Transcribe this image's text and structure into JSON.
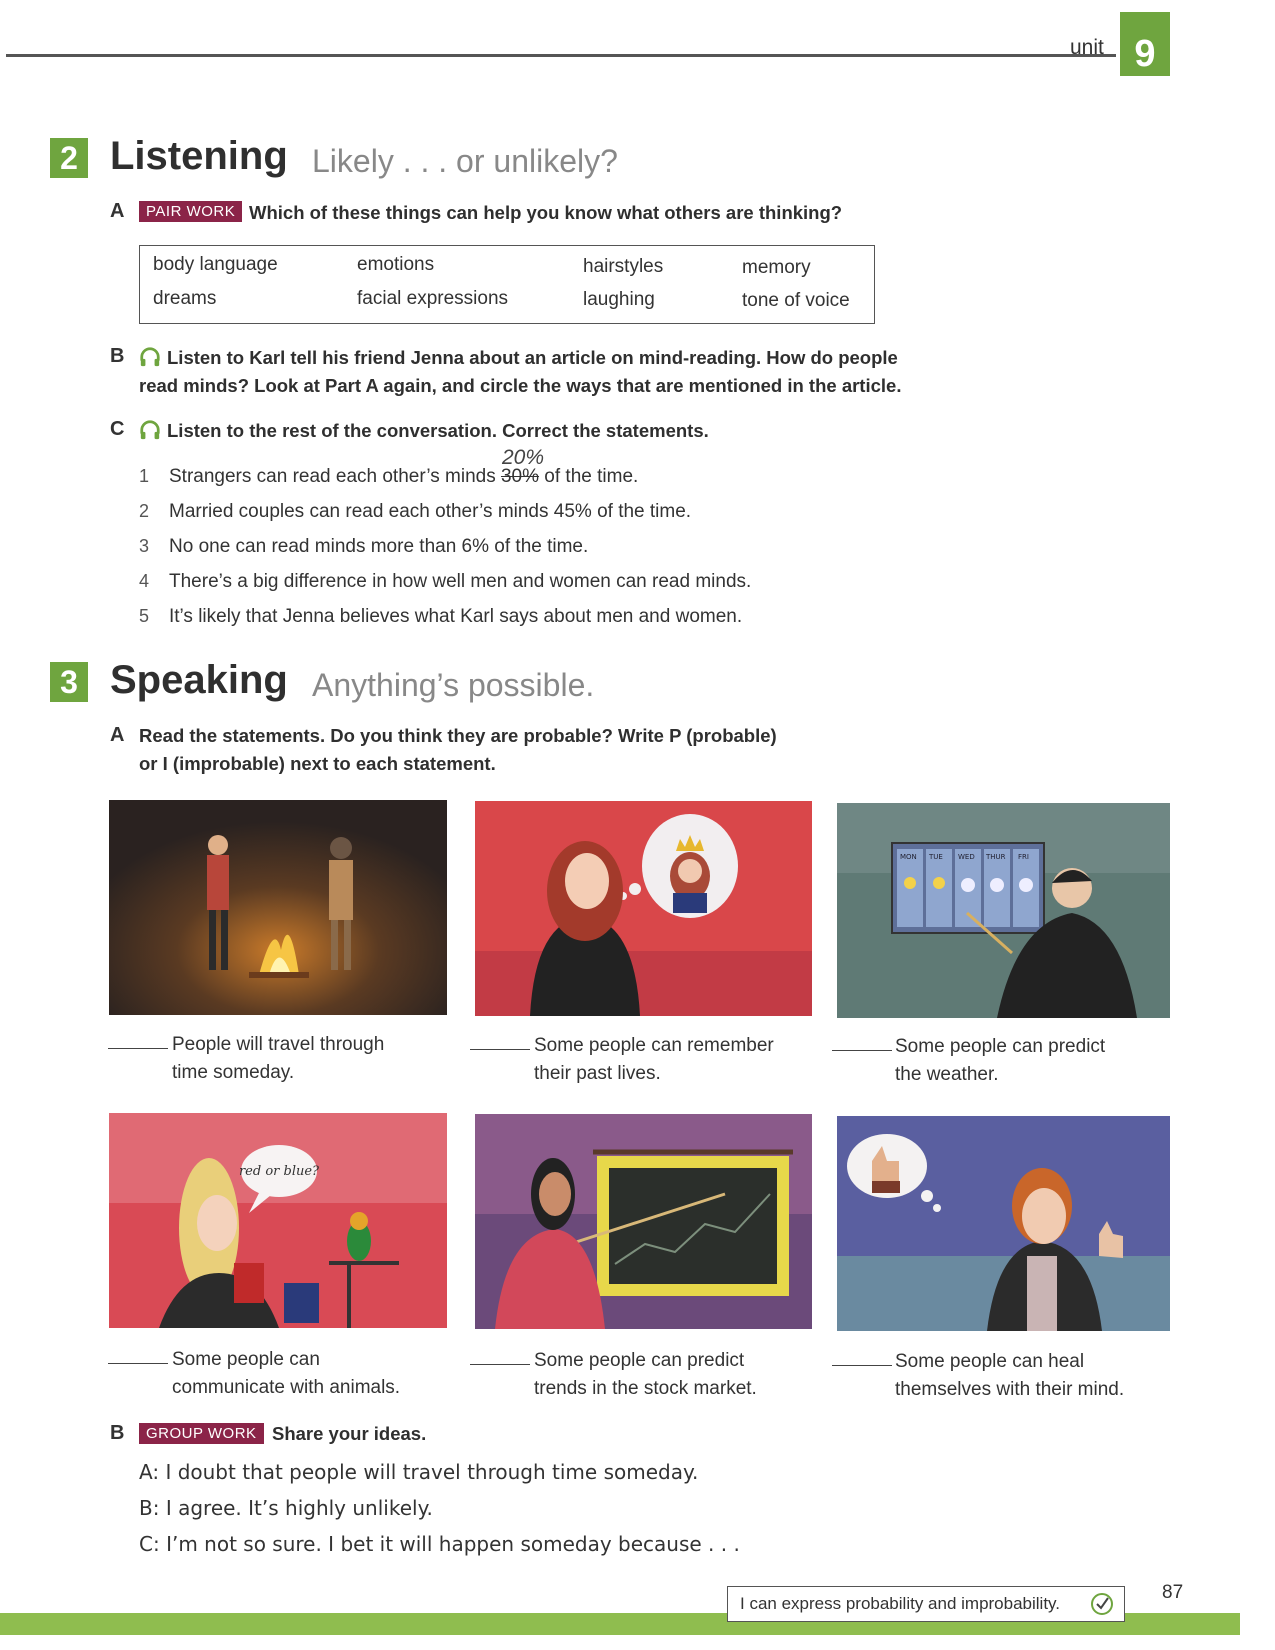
{
  "header": {
    "unit_label": "unit",
    "unit_number": "9"
  },
  "section2": {
    "number": "2",
    "title": "Listening",
    "subtitle": "Likely . . . or unlikely?",
    "partA": {
      "letter": "A",
      "badge": "PAIR WORK",
      "instruction": "Which of these things can help you know what others are thinking?",
      "words": [
        "body language",
        "emotions",
        "hairstyles",
        "memory",
        "dreams",
        "facial expressions",
        "laughing",
        "tone of voice"
      ]
    },
    "partB": {
      "letter": "B",
      "line1": "Listen to Karl tell his friend Jenna about an article on mind-reading. How do people",
      "line2": "read minds? Look at Part A again, and circle the ways that are mentioned in the article."
    },
    "partC": {
      "letter": "C",
      "instruction": "Listen to the rest of the conversation. Correct the statements.",
      "correction": "20%",
      "statements": [
        {
          "n": "1",
          "before": "Strangers can read each other’s minds ",
          "struck": "30%",
          "after": " of the time."
        },
        {
          "n": "2",
          "text": "Married couples can read each other’s minds 45% of the time."
        },
        {
          "n": "3",
          "text": "No one can read minds more than 6% of the time."
        },
        {
          "n": "4",
          "text": "There’s a big difference in how well men and women can read minds."
        },
        {
          "n": "5",
          "text": "It’s likely that Jenna believes what Karl says about men and women."
        }
      ]
    }
  },
  "section3": {
    "number": "3",
    "title": "Speaking",
    "subtitle": "Anything’s possible.",
    "partA": {
      "letter": "A",
      "line1": "Read the statements. Do you think they are probable? Write P (probable)",
      "line2": "or I (improbable) next to each statement."
    },
    "pictures": [
      {
        "line1": "People will travel through",
        "line2": "time someday."
      },
      {
        "line1": "Some people can remember",
        "line2": "their past lives."
      },
      {
        "line1": "Some people can predict",
        "line2": "the weather."
      },
      {
        "line1": "Some people can",
        "line2": "communicate with animals.",
        "bubble": "red or blue?"
      },
      {
        "line1": "Some people can predict",
        "line2": "trends in the stock market."
      },
      {
        "line1": "Some people can heal",
        "line2": "themselves with their mind."
      }
    ],
    "weather_days": [
      "MON",
      "TUE",
      "WED",
      "THUR",
      "FRI"
    ],
    "partB": {
      "letter": "B",
      "badge": "GROUP WORK",
      "instruction": "Share your ideas.",
      "dialog": [
        {
          "speaker": "A:",
          "text": "I doubt that people will travel through time someday."
        },
        {
          "speaker": "B:",
          "text": "I agree. It’s highly unlikely."
        },
        {
          "speaker": "C:",
          "text": "I’m not so sure. I bet it will happen someday because . . ."
        }
      ]
    }
  },
  "footer": {
    "can_do": "I can express probability and improbability.",
    "page_number": "87"
  }
}
